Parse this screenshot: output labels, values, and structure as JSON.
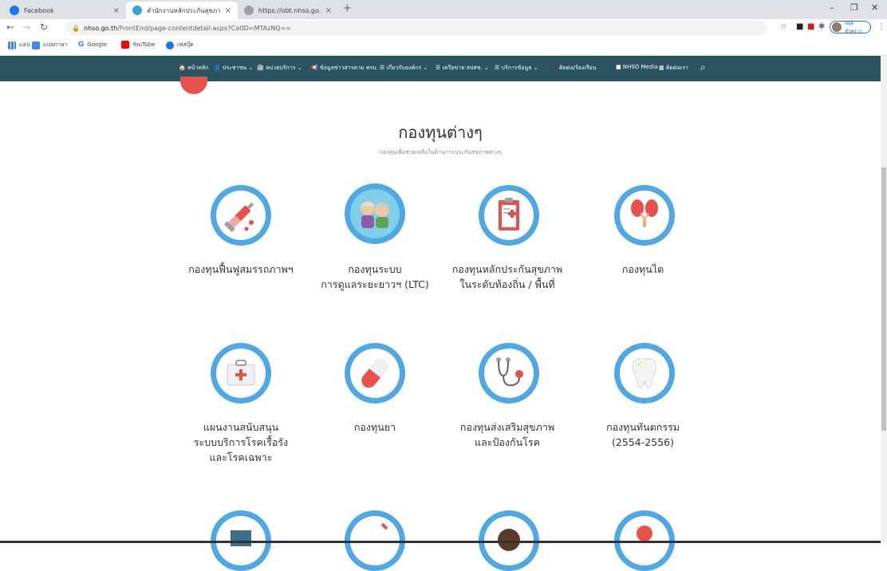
{
  "browser": {
    "tabs": [
      {
        "label": "Facebook",
        "favicon": "facebook-icon"
      },
      {
        "label": "สำนักงานหลักประกันสุขภาพแห่งชาติ",
        "favicon": "nhso-icon"
      },
      {
        "label": "https://obt.nhso.go.th/obt/home",
        "favicon": "globe-icon"
      }
    ],
    "new_tab": "+",
    "url_domain": "nhso.go.th",
    "url_path": "/FrontEnd/page-contentdetail.aspx?CatID=MTAzNQ==",
    "profile_label": "หยุดชั่วคราว",
    "bookmarks": [
      {
        "label": "แอป",
        "icon": "apps-icon"
      },
      {
        "label": "แปลภาษา",
        "icon": "translate-icon"
      },
      {
        "label": "Google",
        "icon": "google-icon"
      },
      {
        "label": "YouTube",
        "icon": "youtube-icon"
      },
      {
        "label": "เฟสบุ๊ค",
        "icon": "facebook-icon"
      }
    ]
  },
  "nav": {
    "items": [
      "🏠 หน้าหลัก",
      "👤 ประชาชน ⌄",
      "🏥 หน่วยบริการ ⌄",
      "📢 ข้อมูลข่าวสารตาม พรบ.",
      "☰ เกี่ยวกับองค์กร ⌄",
      "☰ เครือข่าย สปสช. ⌄",
      "☰ บริการข้อมูล ⌄",
      "📞 ติดต่อ/ร้องเรียน",
      "■ NHSO Media",
      "▦ ติดต่อเรา"
    ]
  },
  "main": {
    "title": "กองทุนต่างๆ",
    "subtitle": "กองทุนเพื่อช่วยเหลือในด้านการประกันสุขภาพต่างๆ",
    "cards": [
      {
        "lines": [
          "กองทุนฟื้นฟูสมรรถภาพฯ"
        ],
        "icon": "syringe-icon"
      },
      {
        "lines": [
          "กองทุนระบบ",
          "การดูแลระยะยาวฯ (LTC)"
        ],
        "icon": "elderly-couple-icon"
      },
      {
        "lines": [
          "กองทุนหลักประกันสุขภาพ",
          "ในระดับท้องถิ่น / พื้นที่"
        ],
        "icon": "clipboard-icon"
      },
      {
        "lines": [
          "กองทุนไต"
        ],
        "icon": "kidney-icon"
      },
      {
        "lines": [
          "แผนงานสนับสนุน",
          "ระบบบริการโรคเรื้อรัง",
          "และโรคเฉพาะ"
        ],
        "icon": "first-aid-kit-icon"
      },
      {
        "lines": [
          "กองทุนยา"
        ],
        "icon": "pill-capsule-icon"
      },
      {
        "lines": [
          "กองทุนส่งเสริมสุขภาพ",
          "และป้องกันโรค"
        ],
        "icon": "stethoscope-icon"
      },
      {
        "lines": [
          "กองทุนทันตกรรม",
          "(2554-2556)"
        ],
        "icon": "tooth-icon"
      }
    ]
  },
  "colors": {
    "nav_bg": "#2a5560",
    "circle": "#4fa8e6",
    "accent_red": "#e8514a"
  }
}
